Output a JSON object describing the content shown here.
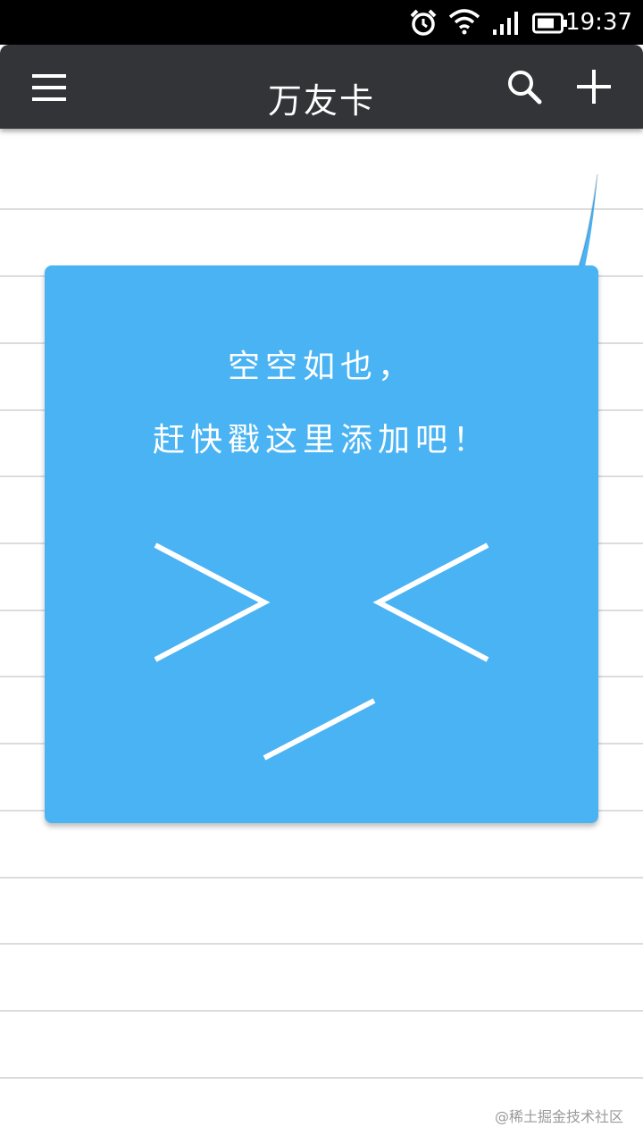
{
  "status_bar": {
    "time": "19:37",
    "icons": [
      "alarm-icon",
      "wifi-icon",
      "signal-icon",
      "battery-icon"
    ]
  },
  "app_bar": {
    "title": "万友卡",
    "icons": [
      "menu-icon",
      "search-icon",
      "add-icon"
    ]
  },
  "empty_state": {
    "line1": "空空如也，",
    "line2": "赶快戳这里添加吧！",
    "face_icon": "squint-face-icon"
  },
  "watermark": "@稀土掘金技术社区",
  "colors": {
    "status_bar": "#000000",
    "app_bar": "#333438",
    "card": "#49b3f3",
    "rule_line": "#dcdcdc",
    "background": "#ffffff"
  }
}
